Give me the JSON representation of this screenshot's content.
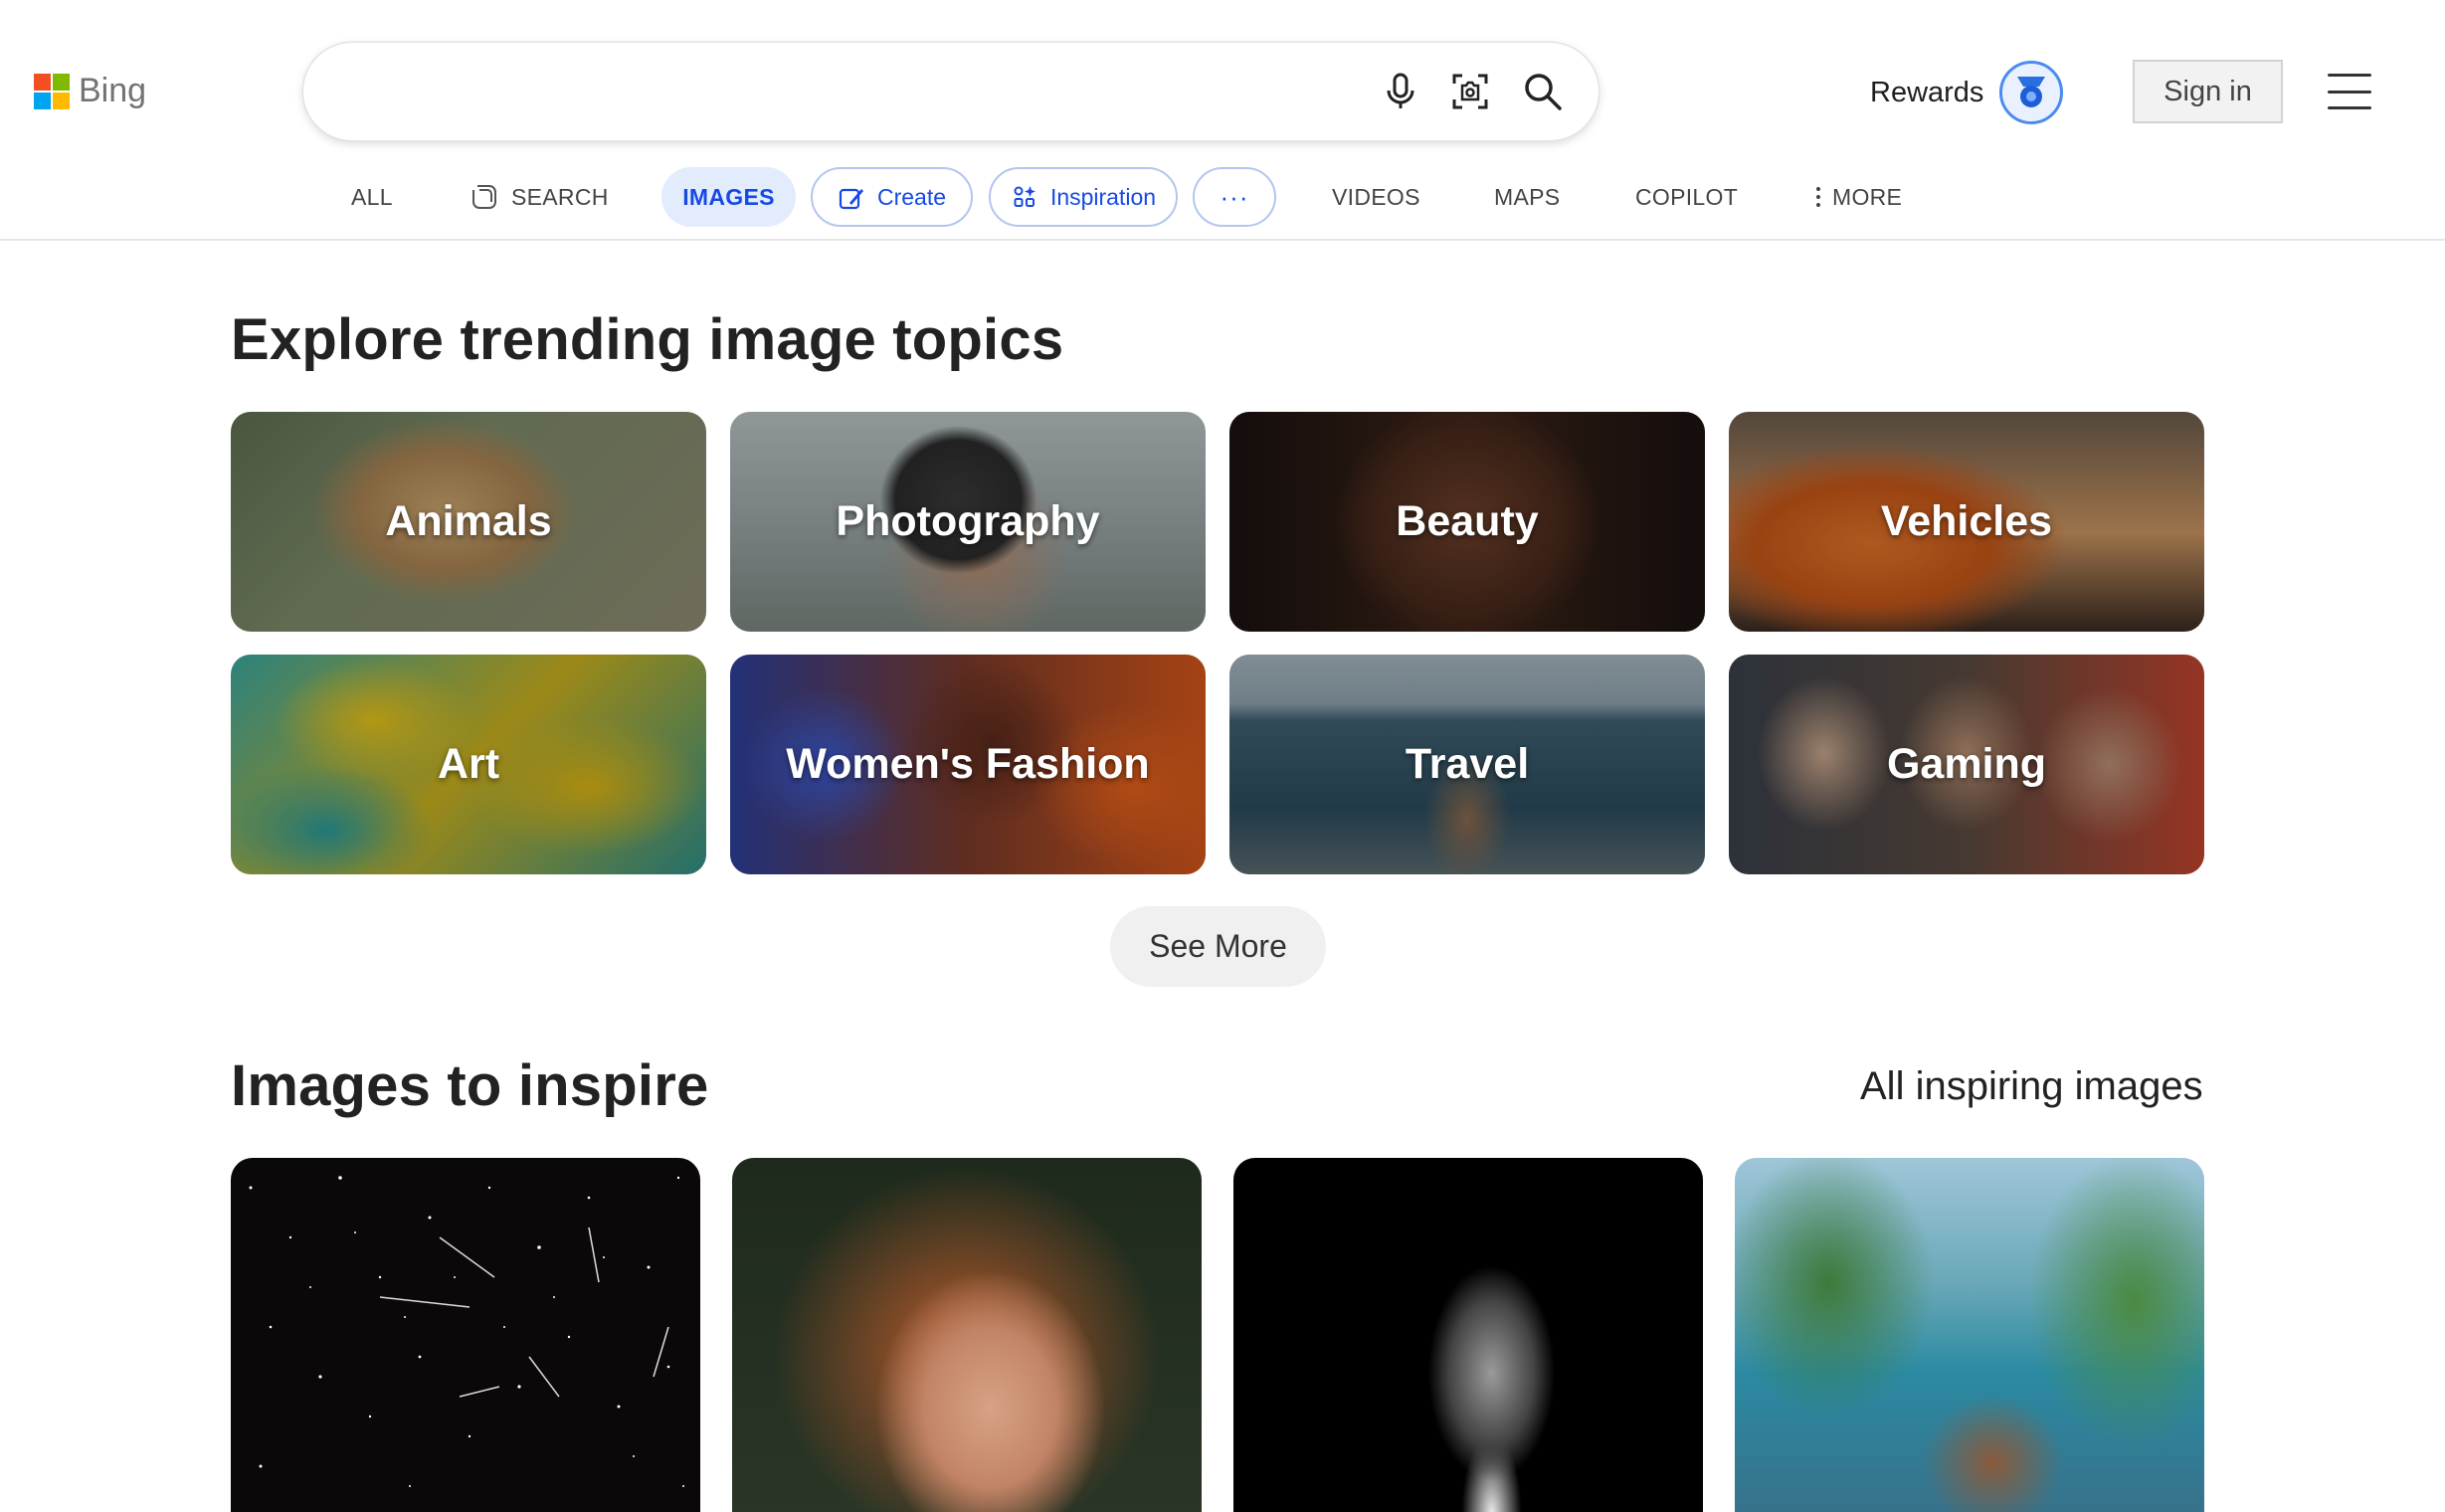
{
  "header": {
    "logo_text": "Bing",
    "search": {
      "value": "",
      "placeholder": ""
    },
    "rewards_label": "Rewards",
    "signin_label": "Sign in"
  },
  "tabs": {
    "all": "ALL",
    "search": "SEARCH",
    "images": "IMAGES",
    "create": "Create",
    "inspiration": "Inspiration",
    "more_pill": "···",
    "videos": "VIDEOS",
    "maps": "MAPS",
    "copilot": "COPILOT",
    "more": "MORE"
  },
  "trending": {
    "title": "Explore trending image topics",
    "topics": [
      {
        "label": "Animals"
      },
      {
        "label": "Photography"
      },
      {
        "label": "Beauty"
      },
      {
        "label": "Vehicles"
      },
      {
        "label": "Art"
      },
      {
        "label": "Women's Fashion"
      },
      {
        "label": "Travel"
      },
      {
        "label": "Gaming"
      }
    ],
    "see_more": "See More"
  },
  "inspire": {
    "title": "Images to inspire",
    "all_link": "All inspiring images",
    "images": [
      {
        "subject": "starry night sky with meteors"
      },
      {
        "subject": "red-haired woman portrait"
      },
      {
        "subject": "dog silhouette on black background"
      },
      {
        "subject": "log cabin on lake island with pine trees"
      }
    ]
  },
  "colors": {
    "accent_blue": "#174ae4",
    "images_tab_bg": "#e3ecfd",
    "pill_border": "#b3c6ef",
    "ms_red": "#f25022",
    "ms_green": "#7fba00",
    "ms_blue": "#00a4ef",
    "ms_yellow": "#ffb900"
  },
  "icons": [
    "microphone-icon",
    "visual-search-icon",
    "search-icon",
    "rewards-medal-icon",
    "hamburger-menu-icon",
    "copilot-search-icon",
    "create-icon",
    "inspiration-icon",
    "more-dots-icon"
  ]
}
